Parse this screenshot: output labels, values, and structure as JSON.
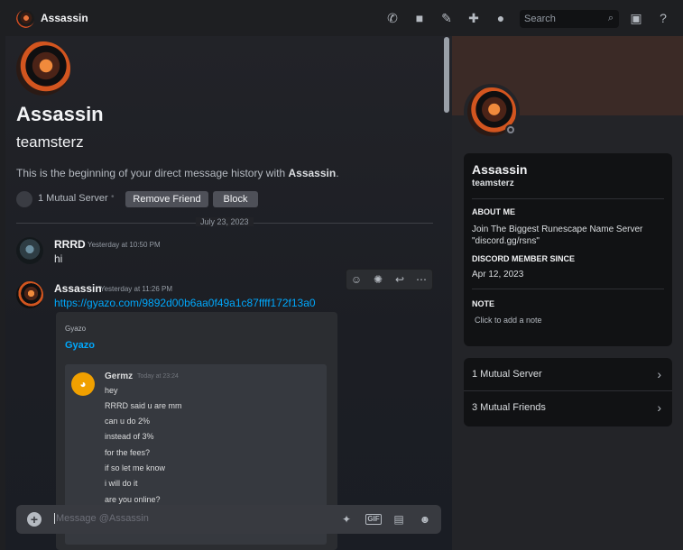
{
  "topbar": {
    "title": "Assassin",
    "search_placeholder": "Search",
    "icons": [
      "phone-call-icon",
      "video-icon",
      "pin-icon",
      "add-user-icon",
      "profile-icon",
      "search-icon",
      "inbox-icon",
      "help-icon"
    ]
  },
  "dm_header": {
    "name": "Assassin",
    "username": "teamsterz",
    "intro_prefix": "This is the beginning of your direct message history with ",
    "intro_name": "Assassin",
    "intro_suffix": ".",
    "mutual_servers": "1 Mutual Server",
    "remove_friend_label": "Remove Friend",
    "block_label": "Block"
  },
  "date_divider": "July 23, 2023",
  "messages": [
    {
      "author": "RRRD",
      "time": "Yesterday at 10:50 PM",
      "text": "hi"
    },
    {
      "author": "Assassin",
      "time": "Yesterday at 11:26 PM",
      "link": "https://gyazo.com/9892d00b6aa0f49a1c87ffff172f13a0"
    }
  ],
  "embed": {
    "provider": "Gyazo",
    "title": "Gyazo",
    "screenshot": {
      "author": "Germz",
      "time": "Today at 23:24",
      "lines": [
        "hey",
        "RRRD said u are mm",
        "can u do 2%",
        "instead of 3%",
        "for the fees?",
        "if so let me know",
        "i will do it",
        "are you online?"
      ]
    }
  },
  "composer": {
    "placeholder": "Message @Assassin",
    "gif_label": "GIF"
  },
  "profile": {
    "name": "Assassin",
    "username": "teamsterz",
    "about_heading": "ABOUT ME",
    "about_text": "Join The Biggest Runescape Name Server \"discord.gg/rsns\"",
    "member_heading": "DISCORD MEMBER SINCE",
    "member_since": "Apr 12, 2023",
    "note_heading": "NOTE",
    "note_placeholder": "Click to add a note",
    "mutual_servers": "1 Mutual Server",
    "mutual_friends": "3 Mutual Friends"
  }
}
